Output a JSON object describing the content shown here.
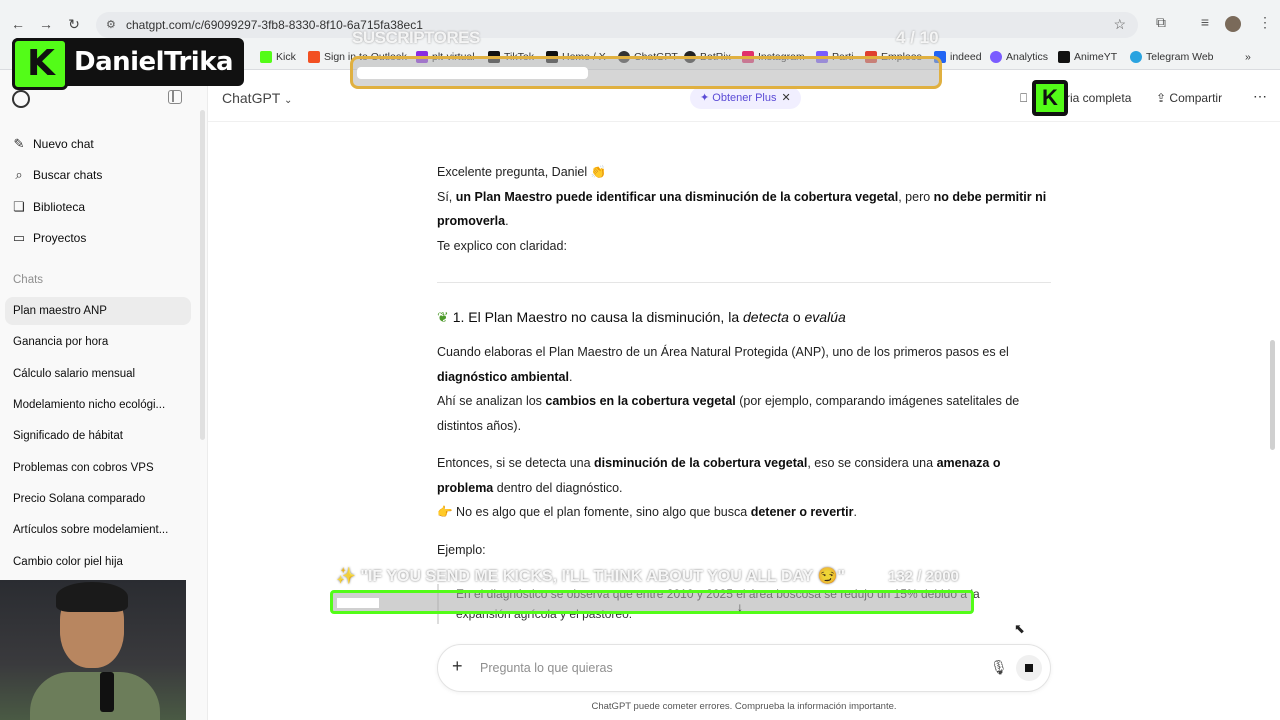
{
  "browser": {
    "url": "chatgpt.com/c/69099297-3fb8-8330-8f10-6a715fa38ec1",
    "bookmarks": [
      {
        "label": "Kick",
        "color": "#53fc18"
      },
      {
        "label": "Sign in to Outlook",
        "color": "#f25022"
      },
      {
        "label": "plt-virtual",
        "color": "#8a2be2"
      },
      {
        "label": "TikTok",
        "color": "#111111"
      },
      {
        "label": "Home / X",
        "color": "#111111"
      },
      {
        "label": "ChatGPT",
        "color": "#333333"
      },
      {
        "label": "BotRix",
        "color": "#222222"
      },
      {
        "label": "Instagram",
        "color": "#e1306c"
      },
      {
        "label": "Parti",
        "color": "#7a5cff"
      },
      {
        "label": "Empleos",
        "color": "#e04030"
      },
      {
        "label": "indeed",
        "color": "#2164f3"
      },
      {
        "label": "Analytics",
        "color": "#7a5cff"
      },
      {
        "label": "AnimeYT",
        "color": "#111111"
      },
      {
        "label": "Telegram Web",
        "color": "#2aa3e0"
      }
    ]
  },
  "sidebar": {
    "actions": [
      {
        "label": "Nuevo chat",
        "icon": "pencil-icon"
      },
      {
        "label": "Buscar chats",
        "icon": "search-icon"
      },
      {
        "label": "Biblioteca",
        "icon": "library-icon"
      },
      {
        "label": "Proyectos",
        "icon": "folder-icon"
      }
    ],
    "chats_heading": "Chats",
    "chats": [
      "Plan maestro ANP",
      "Ganancia por hora",
      "Cálculo salario mensual",
      "Modelamiento nicho ecológi...",
      "Significado de hábitat",
      "Problemas con cobros VPS",
      "Precio Solana comparado",
      "Artículos sobre modelamient...",
      "Cambio color piel hija"
    ],
    "active_chat_index": 0
  },
  "header": {
    "model": "ChatGPT",
    "plus_pill": "Obtener Plus",
    "temp_chat": "ria completa",
    "share": "Compartir"
  },
  "message": {
    "greeting": "Excelente pregunta, Daniel 👏",
    "line1_pre": "Sí, ",
    "line1_bold1": "un Plan Maestro puede identificar una disminución de la cobertura vegetal",
    "line1_mid": ", pero ",
    "line1_bold2": "no debe permitir ni promoverla",
    "line1_end": ".",
    "line2": "Te explico con claridad:",
    "section_title_pre": "1. El Plan Maestro no causa la disminución, la ",
    "section_title_em1": "detecta",
    "section_title_mid": " o ",
    "section_title_em2": "evalúa",
    "p1_a": "Cuando elaboras el Plan Maestro de un Área Natural Protegida (ANP), uno de los primeros pasos es el ",
    "p1_b": "diagnóstico ambiental",
    "p1_c": ".",
    "p1_d": "Ahí se analizan los ",
    "p1_e": "cambios en la cobertura vegetal",
    "p1_f": " (por ejemplo, comparando imágenes satelitales de distintos años).",
    "p2_a": "Entonces, si se detecta una ",
    "p2_b": "disminución de la cobertura vegetal",
    "p2_c": ", eso se considera una ",
    "p2_d": "amenaza o problema",
    "p2_e": " dentro del diagnóstico.",
    "p3_a": "👉 No es algo que el plan fomente, sino algo que busca ",
    "p3_b": "detener o revertir",
    "p3_c": ".",
    "example_label": "Ejemplo:",
    "quote": "En el diagnóstico se observa que entre 2010 y 2025 el área boscosa se redujo un 15% debido a la expansión agrícola y el pastoreo."
  },
  "composer": {
    "placeholder": "Pregunta lo que quieras",
    "disclaimer": "ChatGPT puede cometer errores. Comprueba la información importante."
  },
  "overlays": {
    "streamer_name": "DanielTrika",
    "sub_goal_label": "SUSCRIPTORES",
    "sub_goal_count": "4 / 10",
    "sub_goal_progress": 0.4,
    "kick_goal_label": "✨ \"IF YOU SEND ME KICKS, I'LL THINK ABOUT YOU ALL DAY 😏\"",
    "kick_goal_count": "132 / 2000",
    "kick_goal_progress": 0.066,
    "k_letter": "K"
  }
}
